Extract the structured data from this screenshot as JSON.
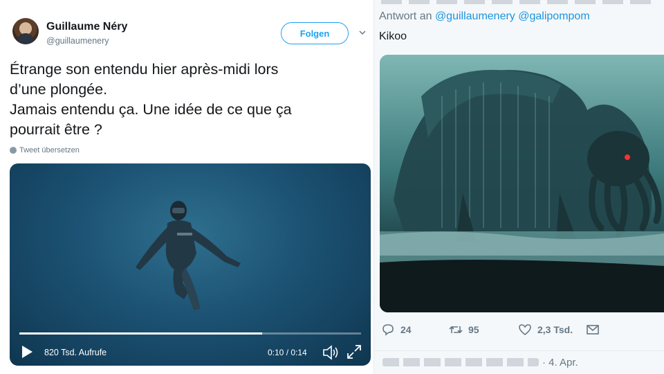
{
  "left_tweet": {
    "display_name": "Guillaume Néry",
    "handle": "@guillaumenery",
    "follow_label": "Folgen",
    "text_lines": [
      "Étrange son entendu hier après-midi lors",
      "d’une plongée.",
      "Jamais entendu ça. Une idée de ce que ça",
      "pourrait être ?"
    ],
    "translate_label": "Tweet übersetzen",
    "video": {
      "views": "820 Tsd. Aufrufe",
      "time": "0:10 / 0:14",
      "progress": 0.71
    }
  },
  "right_tweet": {
    "reply_prefix": "Antwort an",
    "mentions": [
      "@guillaumenery",
      "@galipompom"
    ],
    "text": "Kikoo",
    "actions": {
      "replies": "24",
      "retweets": "95",
      "likes": "2,3 Tsd."
    },
    "date": "· 4. Apr."
  },
  "icons": {
    "caret": "chevron-down-icon",
    "globe": "globe-icon",
    "play": "play-icon",
    "volume": "volume-icon",
    "expand": "expand-icon",
    "reply": "reply-icon",
    "retweet": "retweet-icon",
    "like": "heart-icon",
    "dm": "envelope-icon"
  },
  "colors": {
    "accent": "#1da1f2",
    "mention": "#1b95e0",
    "muted": "#657786"
  }
}
